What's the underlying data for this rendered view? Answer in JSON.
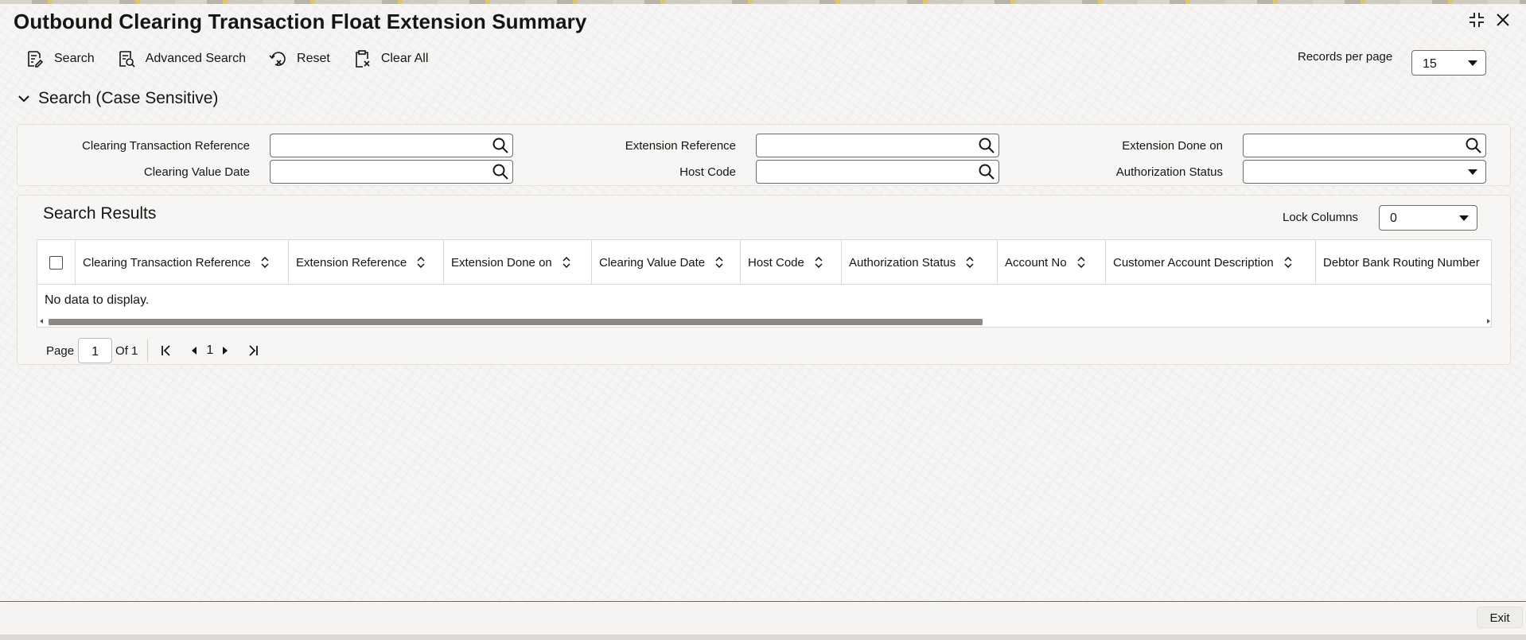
{
  "window": {
    "title": "Outbound Clearing Transaction Float Extension Summary"
  },
  "toolbar": {
    "search_label": "Search",
    "advanced_search_label": "Advanced Search",
    "reset_label": "Reset",
    "clear_all_label": "Clear All",
    "records_per_page_label": "Records per page",
    "records_per_page_value": "15"
  },
  "search": {
    "section_label": "Search (Case Sensitive)",
    "fields": {
      "clearing_txn_ref": {
        "label": "Clearing Transaction Reference",
        "value": ""
      },
      "extension_ref": {
        "label": "Extension Reference",
        "value": ""
      },
      "extension_done_on": {
        "label": "Extension Done on",
        "value": ""
      },
      "clearing_value_date": {
        "label": "Clearing Value Date",
        "value": ""
      },
      "host_code": {
        "label": "Host Code",
        "value": ""
      },
      "authorization_status": {
        "label": "Authorization Status",
        "value": ""
      }
    }
  },
  "results": {
    "title": "Search Results",
    "lock_columns_label": "Lock Columns",
    "lock_columns_value": "0",
    "columns": [
      "Clearing Transaction Reference",
      "Extension Reference",
      "Extension Done on",
      "Clearing Value Date",
      "Host Code",
      "Authorization Status",
      "Account No",
      "Customer Account Description",
      "Debtor Bank Routing Number"
    ],
    "empty_text": "No data to display."
  },
  "pagination": {
    "page_label": "Page",
    "page_value": "1",
    "of_label": "Of 1",
    "current_page": "1"
  },
  "footer": {
    "exit_label": "Exit"
  },
  "colors": {
    "text": "#161513",
    "border": "#6f6c68",
    "panel": "#f7f6f4",
    "scroll_thumb": "#8d8a86"
  }
}
